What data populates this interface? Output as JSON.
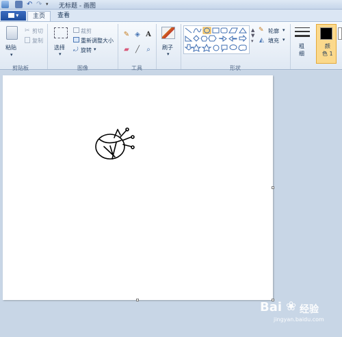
{
  "window": {
    "title": "无标题 - 画图"
  },
  "menu": {
    "file_label": "▾"
  },
  "tabs": [
    {
      "label": "主页"
    },
    {
      "label": "查看"
    }
  ],
  "clipboard": {
    "paste": "粘贴",
    "cut": "剪切",
    "copy": "复制",
    "group": "剪贴板"
  },
  "image": {
    "select": "选择",
    "crop": "裁剪",
    "resize": "重新调整大小",
    "rotate": "旋转",
    "group": "图像"
  },
  "tools": {
    "group": "工具"
  },
  "brushes": {
    "label": "刷子"
  },
  "shapes": {
    "outline": "轮廓",
    "fill": "填充",
    "group": "形状"
  },
  "size": {
    "label": "粗\n细"
  },
  "color1": {
    "label": "颜\n色 1"
  },
  "watermark": {
    "brand": "Bai",
    "site": "经验",
    "url": "jingyan.baidu.com"
  },
  "colors": {
    "accent": "#1f4e9e",
    "canvas": "#ffffff",
    "workspace": "#c8d6e6"
  }
}
